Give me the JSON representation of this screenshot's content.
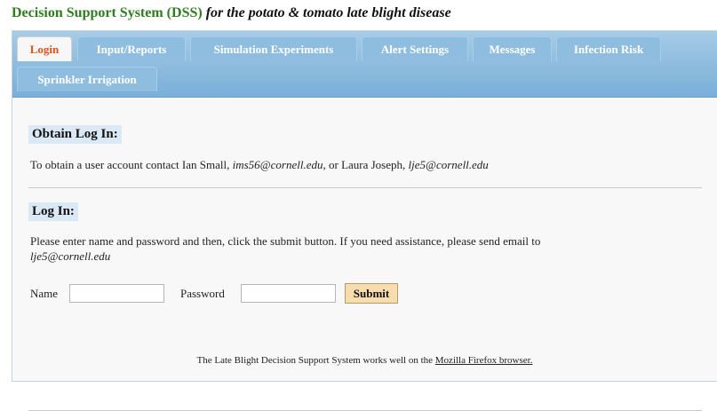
{
  "header": {
    "title": "Decision Support System (DSS)",
    "subtitle": "for the potato & tomato late blight disease"
  },
  "tabs": [
    {
      "label": "Login",
      "active": true
    },
    {
      "label": "Input/Reports",
      "active": false
    },
    {
      "label": "Simulation Experiments",
      "active": false
    },
    {
      "label": "Alert Settings",
      "active": false
    },
    {
      "label": "Messages",
      "active": false
    },
    {
      "label": "Infection Risk",
      "active": false
    },
    {
      "label": "Sprinkler Irrigation",
      "active": false
    }
  ],
  "obtain": {
    "heading": "Obtain Log In:",
    "text_pre": "To obtain a user account contact Ian Small,",
    "email1": "ims56@cornell.edu",
    "text_mid": ", or Laura Joseph,",
    "email2": "lje5@cornell.edu"
  },
  "login": {
    "heading": "Log In:",
    "instructions": "Please enter name and password and then, click the submit button. If you need assistance, please send email to",
    "help_email": "lje5@cornell.edu",
    "name_label": "Name",
    "name_value": "",
    "password_label": "Password",
    "password_value": "",
    "submit_label": "Submit"
  },
  "footer": {
    "text": "The Late Blight Decision Support System works well on the",
    "link": "Mozilla Firefox browser."
  },
  "colors": {
    "title_green": "#2e7d1f",
    "tabbar_blue": "#79afd8",
    "active_tab_text": "#d9531e",
    "heading_bg": "#dbe9f7",
    "submit_bg": "#f7dcae"
  }
}
